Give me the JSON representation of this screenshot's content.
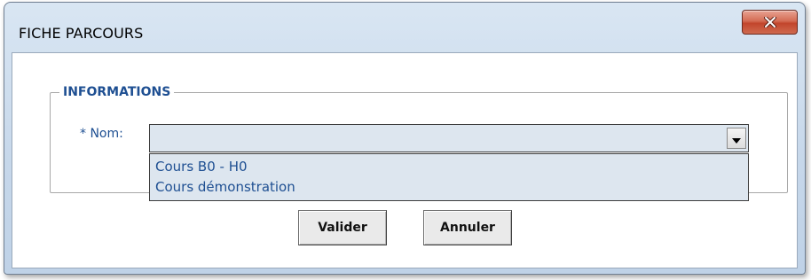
{
  "window": {
    "title": "FICHE PARCOURS",
    "close_icon": "close-x-icon",
    "close_label": "x"
  },
  "group": {
    "legend": "INFORMATIONS"
  },
  "name_field": {
    "label": "* Nom:",
    "value": "",
    "options": [
      "Cours B0 - H0",
      "Cours démonstration"
    ]
  },
  "buttons": {
    "ok_label": "Valider",
    "cancel_label": "Annuler"
  },
  "colors": {
    "label_text": "#1e4f92",
    "close_button": "#c2452c",
    "combo_background": "#dde6ef"
  }
}
